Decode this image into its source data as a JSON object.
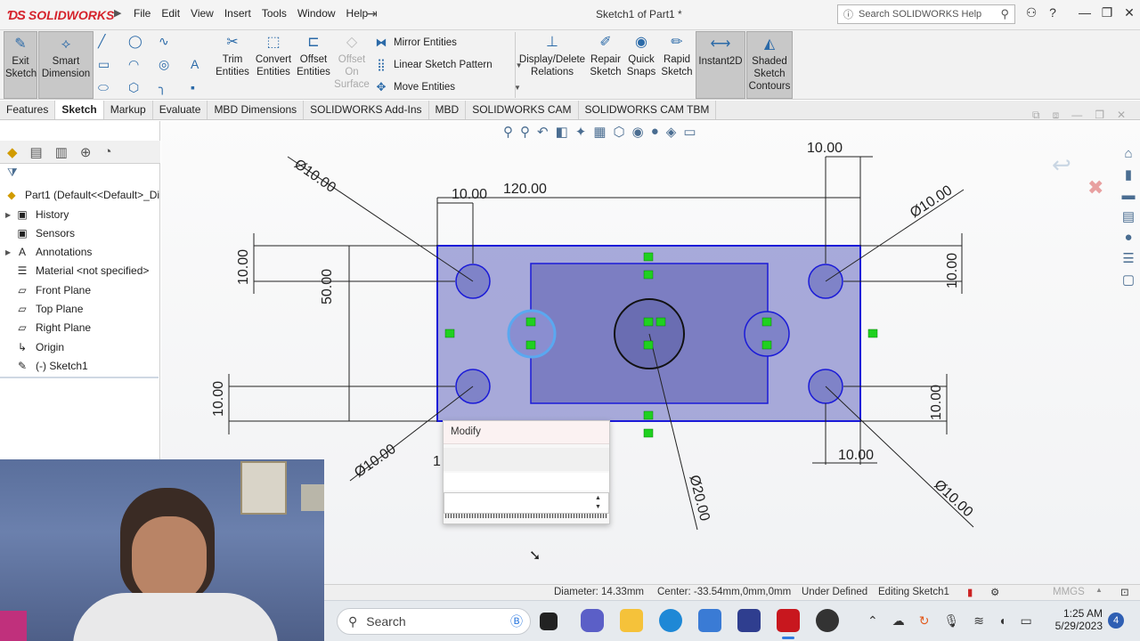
{
  "app": {
    "logo_text": "SOLIDWORKS",
    "doc_title": "Sketch1 of Part1 *"
  },
  "menu": [
    "File",
    "Edit",
    "View",
    "Insert",
    "Tools",
    "Window",
    "Help"
  ],
  "search": {
    "placeholder": "Search SOLIDWORKS Help"
  },
  "ribbon": {
    "exit_sketch": "Exit Sketch",
    "smart_dimension": "Smart Dimension",
    "trim_entities": "Trim Entities",
    "convert_entities": "Convert Entities",
    "offset_entities": "Offset Entities",
    "offset_on_surface": "Offset On Surface",
    "mirror_entities": "Mirror Entities",
    "linear_sketch_pattern": "Linear Sketch Pattern",
    "move_entities": "Move Entities",
    "display_delete_relations": "Display/Delete Relations",
    "repair_sketch": "Repair Sketch",
    "quick_snaps": "Quick Snaps",
    "rapid_sketch": "Rapid Sketch",
    "instant2d": "Instant2D",
    "shaded_sketch_contours": "Shaded Sketch Contours"
  },
  "tabs": [
    "Features",
    "Sketch",
    "Markup",
    "Evaluate",
    "MBD Dimensions",
    "SOLIDWORKS Add-Ins",
    "MBD",
    "SOLIDWORKS CAM",
    "SOLIDWORKS CAM TBM"
  ],
  "active_tab": "Sketch",
  "tree": {
    "part": "Part1  (Default<<Default>_Di",
    "items": [
      "History",
      "Sensors",
      "Annotations",
      "Material <not specified>",
      "Front Plane",
      "Top Plane",
      "Right Plane",
      "Origin",
      "(-) Sketch1"
    ]
  },
  "dimensions": {
    "d120": "120.00",
    "d10_top": "10.00",
    "d10_topright": "10.00",
    "d50": "50.00",
    "d10_lefttop": "10.00",
    "d10_leftbot": "10.00",
    "d10_righttop": "10.00",
    "d10_rightbot": "10.00",
    "d10_botright": "10.00",
    "d10_botleft_partial": "1",
    "dia_tl": "Ø10.00",
    "dia_tr": "Ø10.00",
    "dia_bl": "Ø10.00",
    "dia_br": "Ø10.00",
    "dia_center": "Ø20.00"
  },
  "modify_dialog": {
    "title": "Modify"
  },
  "status": {
    "diameter": "Diameter: 14.33mm",
    "center": "Center: -33.54mm,0mm,0mm",
    "state": "Under Defined",
    "editing": "Editing Sketch1",
    "units": "MMGS"
  },
  "taskbar": {
    "search_placeholder": "Search",
    "time": "1:25 AM",
    "date": "5/29/2023",
    "badge": "4"
  }
}
